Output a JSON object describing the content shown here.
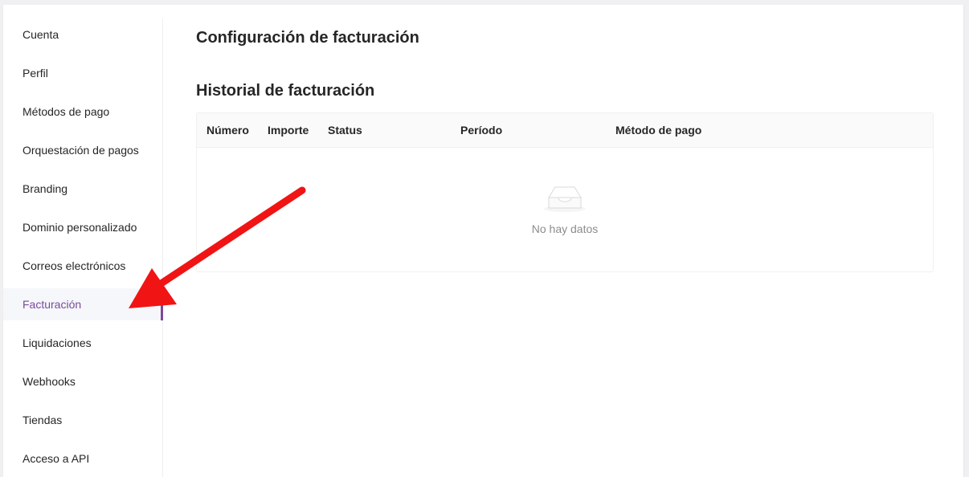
{
  "sidebar": {
    "items": [
      {
        "label": "Cuenta"
      },
      {
        "label": "Perfil"
      },
      {
        "label": "Métodos de pago"
      },
      {
        "label": "Orquestación de pagos"
      },
      {
        "label": "Branding"
      },
      {
        "label": "Dominio personalizado"
      },
      {
        "label": "Correos electrónicos"
      },
      {
        "label": "Facturación",
        "active": true
      },
      {
        "label": "Liquidaciones"
      },
      {
        "label": "Webhooks"
      },
      {
        "label": "Tiendas"
      },
      {
        "label": "Acceso a API"
      }
    ]
  },
  "main": {
    "page_title": "Configuración de facturación",
    "section_title": "Historial de facturación",
    "table": {
      "columns": [
        "Número",
        "Importe",
        "Status",
        "Período",
        "Método de pago"
      ],
      "rows": [],
      "empty_text": "No hay datos",
      "empty_icon": "empty-inbox-icon"
    }
  },
  "annotation": {
    "icon": "red-arrow-icon",
    "color": "#f01414"
  },
  "colors": {
    "accent": "#7b4a9c",
    "active_bg": "#f5f7fa"
  }
}
